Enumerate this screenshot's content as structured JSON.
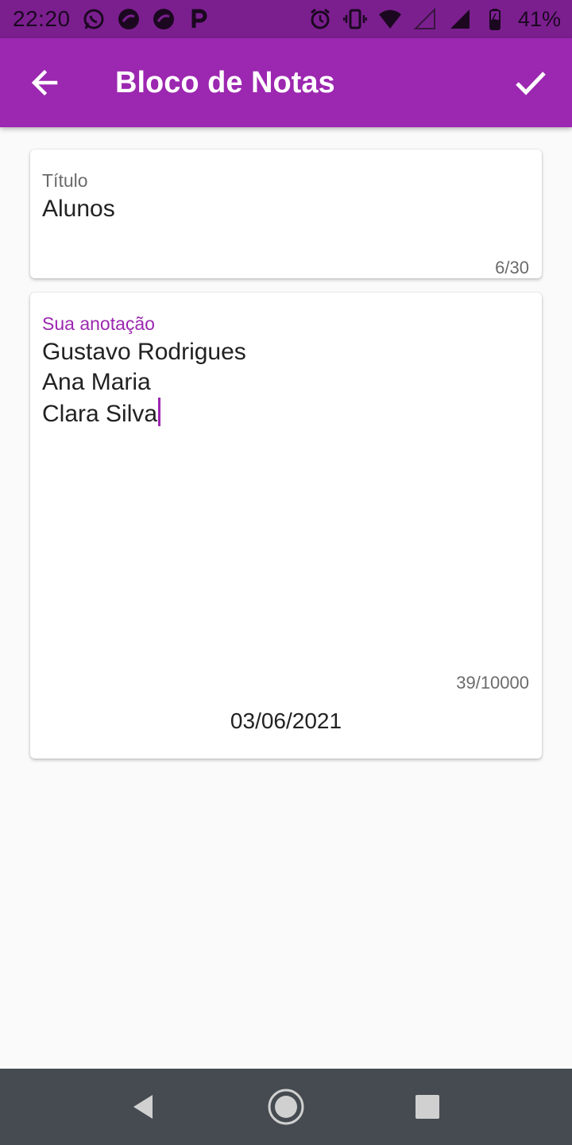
{
  "status_bar": {
    "time": "22:20",
    "battery_percent": "41%",
    "left_icons": [
      "whatsapp-icon",
      "app-notification-icon",
      "app-notification-icon",
      "p-app-icon"
    ],
    "right_icons": [
      "alarm-icon",
      "vibrate-icon",
      "wifi-icon",
      "signal-empty-icon",
      "signal-icon",
      "battery-icon"
    ]
  },
  "app_bar": {
    "title": "Bloco de Notas",
    "back_icon": "arrow-left-icon",
    "confirm_icon": "check-icon",
    "color": "#9c27b0"
  },
  "title_field": {
    "label": "Título",
    "value": "Alunos",
    "counter": "6/30"
  },
  "note_field": {
    "label": "Sua anotação",
    "lines": [
      "Gustavo Rodrigues",
      "Ana Maria",
      "Clara Silva"
    ],
    "counter": "39/10000",
    "label_color": "#9c27b0"
  },
  "date": "03/06/2021",
  "nav_bar": {
    "buttons": [
      "back-triangle-icon",
      "home-circle-icon",
      "recents-square-icon"
    ]
  }
}
